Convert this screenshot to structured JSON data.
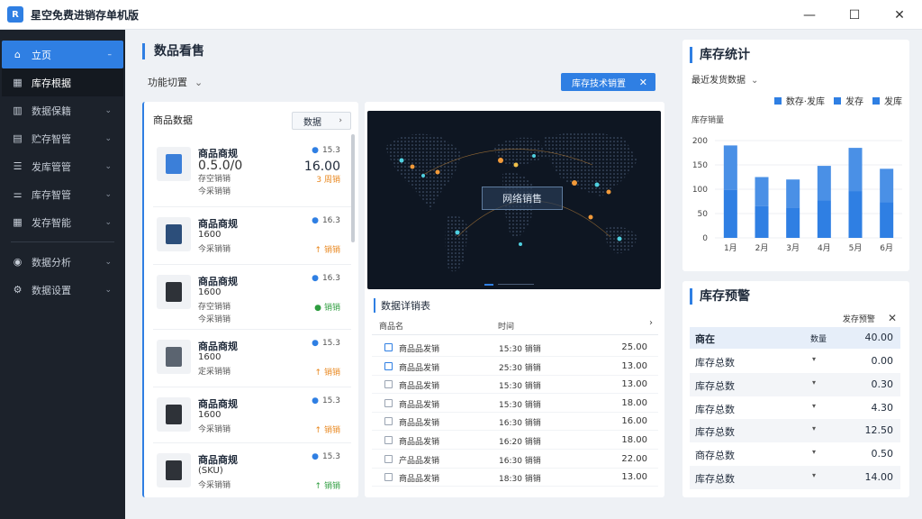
{
  "app": {
    "logo": "R",
    "title": "星空免费进销存单机版"
  },
  "window": {
    "minimize": "—",
    "maximize": "☐",
    "close": "✕"
  },
  "sidebar": {
    "items": [
      {
        "label": "立页",
        "icon": "home-icon",
        "glyph": "⌂",
        "chevron": "–",
        "state": "active"
      },
      {
        "label": "库存根据",
        "icon": "grid-icon",
        "glyph": "▦",
        "chevron": "",
        "state": "sub"
      },
      {
        "label": "数据保籍",
        "icon": "bar-chart-icon",
        "glyph": "▥",
        "chevron": "⌄",
        "state": ""
      },
      {
        "label": "贮存智管",
        "icon": "table-icon",
        "glyph": "▤",
        "chevron": "⌄",
        "state": ""
      },
      {
        "label": "发库管管",
        "icon": "list-icon",
        "glyph": "☰",
        "chevron": "⌄",
        "state": ""
      },
      {
        "label": "库存智管",
        "icon": "sliders-icon",
        "glyph": "⚌",
        "chevron": "⌄",
        "state": ""
      },
      {
        "label": "发存智能",
        "icon": "dashboard-icon",
        "glyph": "▦",
        "chevron": "⌄",
        "state": ""
      },
      {
        "label": "数据分析",
        "icon": "globe-icon",
        "glyph": "◉",
        "chevron": "⌄",
        "state": ""
      },
      {
        "label": "数据设置",
        "icon": "gear-icon",
        "glyph": "⚙",
        "chevron": "⌄",
        "state": ""
      }
    ]
  },
  "main": {
    "title": "数品看售",
    "function_select": "功能切置",
    "filter_chip": "库存技术销置",
    "filter_close": "✕"
  },
  "products": {
    "title": "商品数据",
    "button": "数据",
    "items": [
      {
        "name": "商品商规",
        "code": "0.5.0/0",
        "code_big": true,
        "sub1": "存空销销",
        "sub2": "今采销销",
        "r1": "15.3",
        "r2": "16.00",
        "r3": "3 周销",
        "arrow": "",
        "status": "orange",
        "thumb": "blue"
      },
      {
        "name": "商品商规",
        "code": "1600",
        "code_big": false,
        "sub1": "今采销销",
        "sub2": "",
        "r1": "16.3",
        "r2": "",
        "r3": "销销",
        "arrow": "↑",
        "status": "orange",
        "thumb": "navy"
      },
      {
        "name": "商品商规",
        "code": "1600",
        "code_big": false,
        "sub1": "存空销销",
        "sub2": "今采销销",
        "r1": "16.3",
        "r2": "",
        "r3": "销销",
        "arrow": "●",
        "status": "green",
        "thumb": "dark"
      },
      {
        "name": "商品商规",
        "code": "1600",
        "code_big": false,
        "sub1": "定采销销",
        "sub2": "",
        "r1": "15.3",
        "r2": "",
        "r3": "销销",
        "arrow": "↑",
        "status": "orange",
        "thumb": "gray"
      },
      {
        "name": "商品商规",
        "code": "1600",
        "code_big": false,
        "sub1": "今采销销",
        "sub2": "",
        "r1": "15.3",
        "r2": "",
        "r3": "销销",
        "arrow": "↑",
        "status": "orange",
        "thumb": "dark"
      },
      {
        "name": "商品商规",
        "code": "(SKU)",
        "code_big": false,
        "sub1": "今采销销",
        "sub2": "",
        "r1": "15.3",
        "r2": "",
        "r3": "销销",
        "arrow": "↑",
        "status": "green",
        "thumb": "dark"
      }
    ]
  },
  "map": {
    "label": "网络销售"
  },
  "data_table": {
    "title": "数据详销表",
    "col_name": "商品名",
    "col_time": "时间",
    "more": "›",
    "rows": [
      {
        "name": "商品品发销",
        "time": "15:30 销销",
        "value": "25.00",
        "checked": true
      },
      {
        "name": "商品品发销",
        "time": "25:30 销销",
        "value": "13.00",
        "checked": true
      },
      {
        "name": "商品品发销",
        "time": "15:30 销销",
        "value": "13.00",
        "checked": false
      },
      {
        "name": "商品品发销",
        "time": "15:30 销销",
        "value": "18.00",
        "checked": false
      },
      {
        "name": "商品品发销",
        "time": "16:30 销销",
        "value": "16.00",
        "checked": false
      },
      {
        "name": "商品品发销",
        "time": "16:20 销销",
        "value": "18.00",
        "checked": false
      },
      {
        "name": "产品品发销",
        "time": "16:30 销销",
        "value": "22.00",
        "checked": false
      },
      {
        "name": "商品品发销",
        "time": "18:30 销销",
        "value": "13.00",
        "checked": false
      }
    ]
  },
  "stats": {
    "title": "库存统计",
    "select": "最近发货数据",
    "unit": "库存销量",
    "legend": [
      "数存·发库",
      "发存",
      "发库"
    ]
  },
  "chart_data": {
    "type": "bar",
    "categories": [
      "1月",
      "2月",
      "3月",
      "4月",
      "5月",
      "6月"
    ],
    "values": [
      190,
      125,
      120,
      148,
      185,
      142
    ],
    "yticks": [
      0,
      50,
      100,
      150,
      200
    ],
    "ylim": [
      0,
      200
    ],
    "color": "#2f7fe3",
    "color_light": "#4a90e6"
  },
  "inventory": {
    "title": "库存预警",
    "filter": "发存预警",
    "filter_close": "✕",
    "head": {
      "name": "商在",
      "mid": "数量",
      "value": "40.00"
    },
    "rows": [
      {
        "name": "库存总数",
        "mid": "▾",
        "value": "0.00"
      },
      {
        "name": "库存总数",
        "mid": "▾",
        "value": "0.30"
      },
      {
        "name": "库存总数",
        "mid": "▾",
        "value": "4.30"
      },
      {
        "name": "库存总数",
        "mid": "▾",
        "value": "12.50"
      },
      {
        "name": "商存总数",
        "mid": "▾",
        "value": "0.50"
      },
      {
        "name": "库存总数",
        "mid": "▾",
        "value": "14.00"
      }
    ]
  },
  "colors": {
    "accent": "#2f7fe3",
    "sidebar": "#1c222b",
    "orange": "#e8871e",
    "green": "#2e9d3f"
  }
}
